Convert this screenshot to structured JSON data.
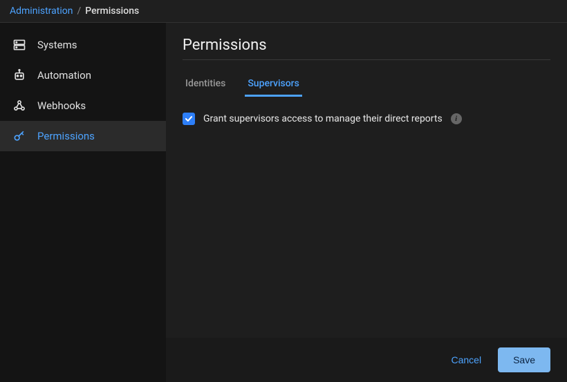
{
  "breadcrumb": {
    "root": "Administration",
    "current": "Permissions"
  },
  "sidebar": {
    "items": [
      {
        "label": "Systems"
      },
      {
        "label": "Automation"
      },
      {
        "label": "Webhooks"
      },
      {
        "label": "Permissions"
      }
    ]
  },
  "page": {
    "title": "Permissions"
  },
  "tabs": {
    "identities": "Identities",
    "supervisors": "Supervisors"
  },
  "option": {
    "grant_supervisors_label": "Grant supervisors access to manage their direct reports"
  },
  "footer": {
    "cancel_label": "Cancel",
    "save_label": "Save"
  }
}
